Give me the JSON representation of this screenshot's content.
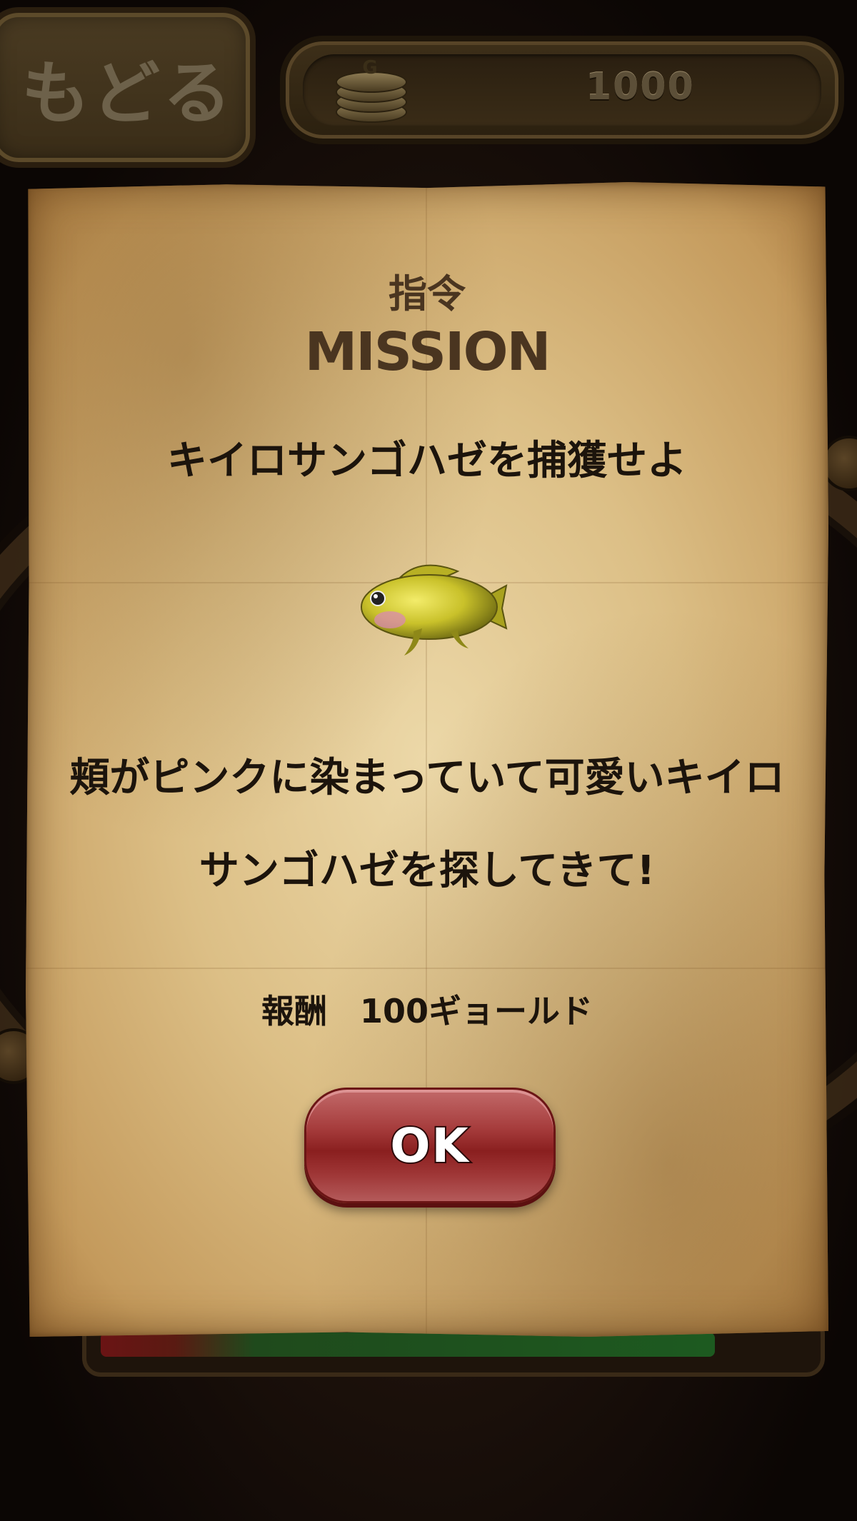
{
  "header": {
    "back_label": "もどる",
    "coin_icon_letter": "G",
    "coin_amount": "1000"
  },
  "mission": {
    "title_kanji": "指令",
    "title_english": "MISSION",
    "target": "キイロサンゴハゼを捕獲せよ",
    "fish_icon": "yellow-goby-fish",
    "description": "頬がピンクに染まっていて可愛いキイロサンゴハゼを探してきて!",
    "reward": "報酬　100ギョールド",
    "ok_label": "OK"
  },
  "progress": {
    "fill_fraction": 0.87
  },
  "colors": {
    "parchment": "#dcbf86",
    "ok_button": "#a63c3c",
    "title_text": "#4a3520"
  }
}
